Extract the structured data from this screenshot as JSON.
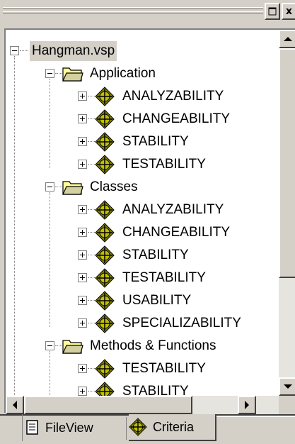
{
  "window": {
    "buttons": [
      {
        "name": "restore",
        "glyph": "◳"
      },
      {
        "name": "close",
        "glyph": "x"
      }
    ]
  },
  "tree": {
    "root": {
      "label": "Hangman.vsp",
      "selected": true
    },
    "groups": [
      {
        "label": "Application",
        "items": [
          "ANALYZABILITY",
          "CHANGEABILITY",
          "STABILITY",
          "TESTABILITY"
        ]
      },
      {
        "label": "Classes",
        "items": [
          "ANALYZABILITY",
          "CHANGEABILITY",
          "STABILITY",
          "TESTABILITY",
          "USABILITY",
          "SPECIALIZABILITY"
        ]
      },
      {
        "label": "Methods & Functions",
        "items": [
          "TESTABILITY",
          "STABILITY"
        ]
      }
    ]
  },
  "tabs": [
    {
      "label": "FileView",
      "icon": "file-view-icon",
      "active": false
    },
    {
      "label": "Criteria",
      "icon": "criteria-icon",
      "active": true
    }
  ],
  "colors": {
    "panel": "#d4d0c8",
    "criteria_icon": "#808000",
    "folder_icon": "#ffff99"
  }
}
